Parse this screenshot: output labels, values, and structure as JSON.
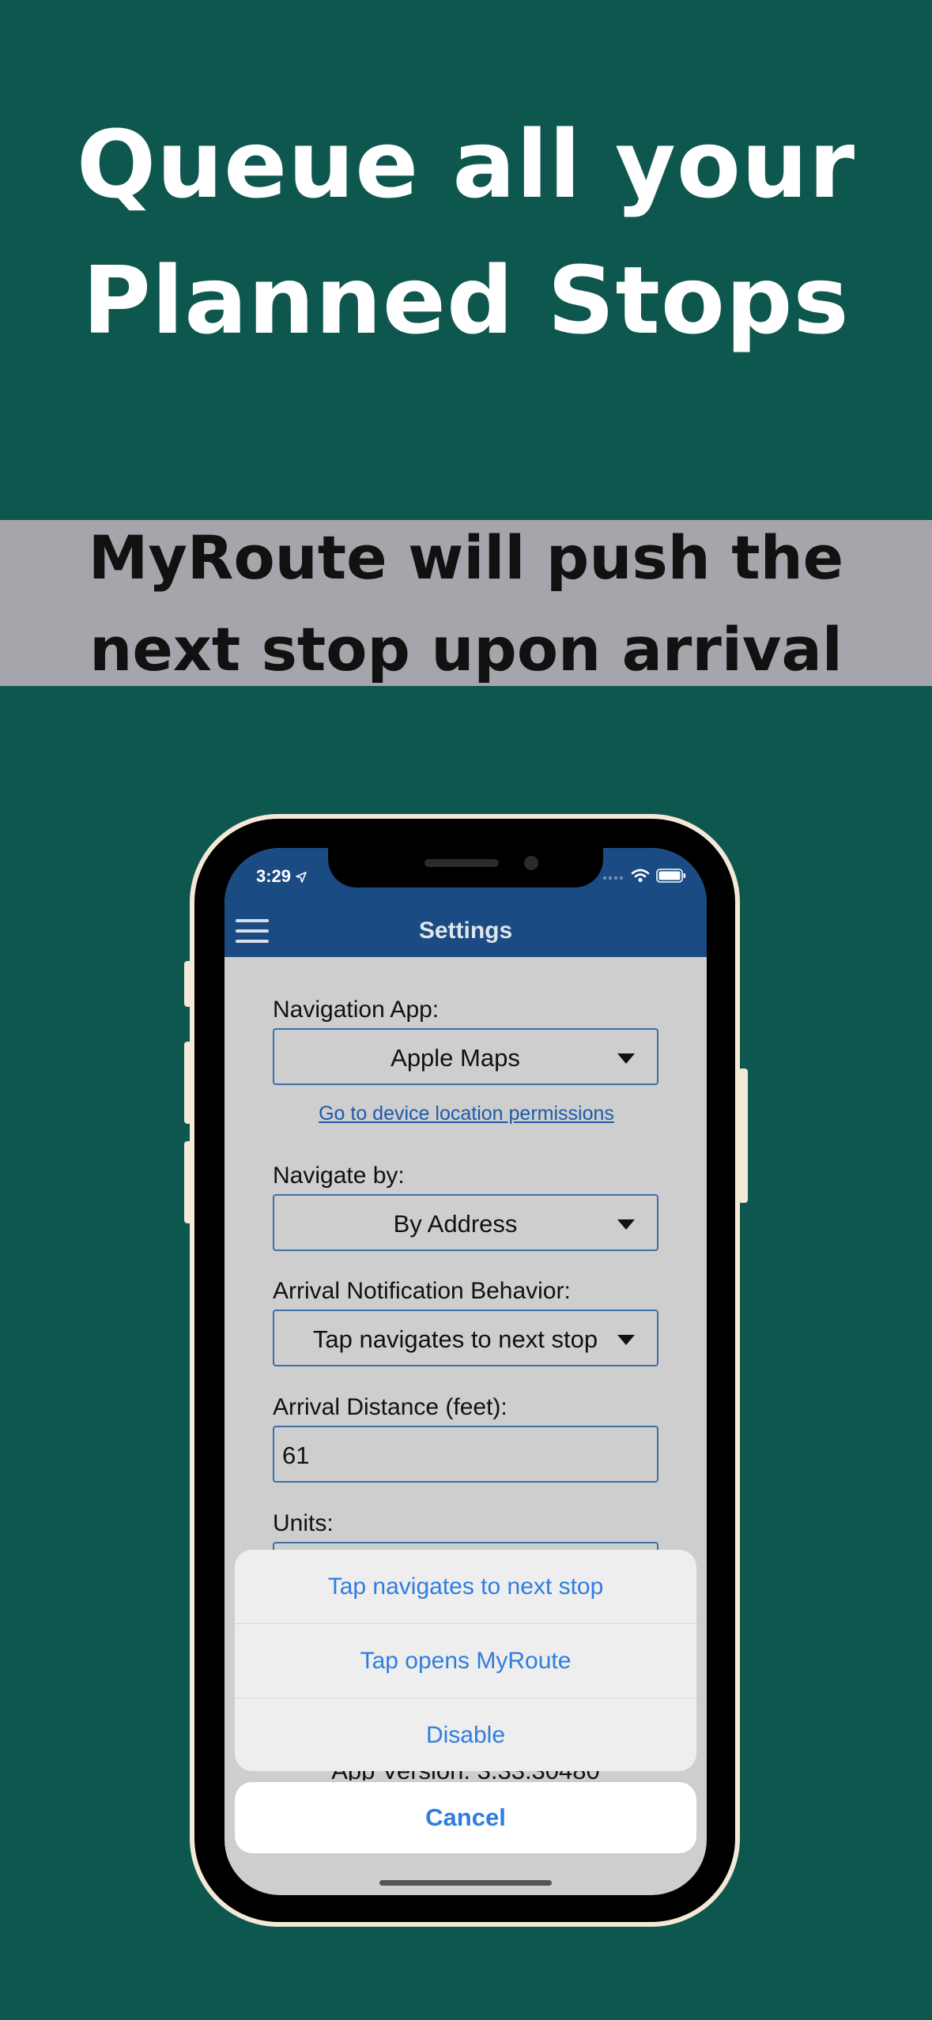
{
  "headline": {
    "line1": "Queue all your",
    "line2": "Planned Stops"
  },
  "subheadline": {
    "line1": "MyRoute will push the",
    "line2": "next stop upon arrival"
  },
  "status_bar": {
    "time": "3:29",
    "icons": [
      "location-arrow-icon",
      "signal-icon",
      "wifi-icon",
      "battery-icon"
    ]
  },
  "nav": {
    "title": "Settings",
    "menu_icon": "hamburger-menu-icon"
  },
  "settings": {
    "navigation_app": {
      "label": "Navigation App:",
      "value": "Apple Maps"
    },
    "permissions_link": "Go to device location permissions",
    "navigate_by": {
      "label": "Navigate by:",
      "value": "By Address"
    },
    "arrival_behavior": {
      "label": "Arrival Notification Behavior:",
      "value": "Tap navigates to next stop"
    },
    "arrival_distance": {
      "label": "Arrival Distance (feet):",
      "value": "61"
    },
    "units": {
      "label": "Units:"
    },
    "app_version": "App Version: 3.33.30480"
  },
  "action_sheet": {
    "options": [
      "Tap navigates to next stop",
      "Tap opens MyRoute",
      "Disable"
    ],
    "cancel": "Cancel"
  },
  "colors": {
    "background": "#0e574e",
    "band": "#a5a6ab",
    "app_bar": "#1b4b83",
    "action_text": "#2f7de0"
  }
}
